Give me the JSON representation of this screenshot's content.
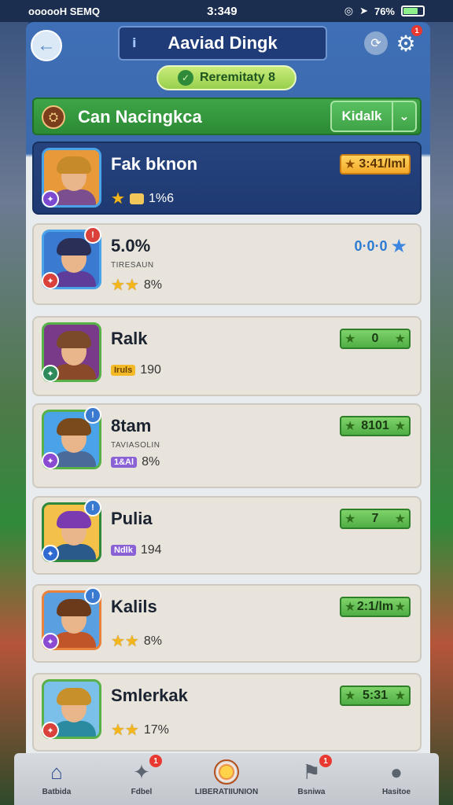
{
  "status_bar": {
    "carrier": "oooooH SEMQ",
    "time": "3:349",
    "battery": "76%",
    "battery_level": 0.76
  },
  "header": {
    "title": "Aaviad Dingk",
    "info_icon": "info-icon",
    "back_icon": "arrow-left-icon",
    "refresh_icon": "refresh-icon",
    "settings_icon": "gear-icon",
    "settings_badge": "1",
    "reward_label": "Reremitaty 8"
  },
  "group": {
    "title": "Can Nacingkca",
    "select_label": "Kidalk"
  },
  "players": [
    {
      "name": "Fak bknon",
      "selected": true,
      "sub": "",
      "stats": "1%6",
      "stars": "★",
      "score": "3:41/lml",
      "score_style": "gold",
      "avatar_colors": {
        "hair": "#c78a2a",
        "body": "#7a4e8f",
        "border": "#4aa2e8",
        "bg": "#e89a3a"
      },
      "badge_color": "#7b4ad1"
    },
    {
      "name": "5.0%",
      "selected": false,
      "sub": "TIRESAUN",
      "stats": "8%",
      "stars": "★★",
      "score": "0·0·0",
      "score_style": "blue",
      "avatar_colors": {
        "hair": "#2a2f58",
        "body": "#5e3d9a",
        "border": "#4aa2e8",
        "bg": "#3a7ad0"
      },
      "badge_color": "#d9413a"
    },
    {
      "name": "Ralk",
      "selected": false,
      "sub": "",
      "stats": "190",
      "tag": "Iruls",
      "score": "0",
      "score_style": "green",
      "avatar_colors": {
        "hair": "#7a4a2a",
        "body": "#8a4a2a",
        "border": "#58b048",
        "bg": "#7a3a8a"
      },
      "badge_color": "#2e8a5a"
    },
    {
      "name": "8tam",
      "selected": false,
      "sub": "TAVIASOLIN",
      "stats": "8%",
      "tag": "1&Al",
      "score": "8101",
      "score_style": "green",
      "avatar_colors": {
        "hair": "#7a4a1a",
        "body": "#4a6a9a",
        "border": "#58b048",
        "bg": "#4aa2e8"
      },
      "badge_color": "#8a4ad1"
    },
    {
      "name": "Pulia",
      "selected": false,
      "sub": "",
      "stats": "194",
      "tag": "Ndlk",
      "score": "7",
      "score_style": "green",
      "avatar_colors": {
        "hair": "#7a3ab0",
        "body": "#2a5a8a",
        "border": "#2e8a3a",
        "bg": "#f3c14a"
      },
      "badge_color": "#2e6ad0"
    },
    {
      "name": "Kalils",
      "selected": false,
      "sub": "",
      "stats": "8%",
      "stars": "★★",
      "score": "2:1/lm",
      "score_style": "green",
      "avatar_colors": {
        "hair": "#6a3a1a",
        "body": "#c0552a",
        "border": "#e8823a",
        "bg": "#5aa0e0"
      },
      "badge_color": "#8a4ad1"
    },
    {
      "name": "Smlerkak",
      "selected": false,
      "sub": "",
      "stats": "17%",
      "stars": "★★",
      "score": "5:31",
      "score_style": "green",
      "avatar_colors": {
        "hair": "#c8902a",
        "body": "#2a8aa0",
        "border": "#58b048",
        "bg": "#7ac0e8"
      },
      "badge_color": "#d9413a"
    }
  ],
  "nav": [
    {
      "label": "Batbida",
      "icon": "home-icon",
      "glyph": "⌂",
      "badge": ""
    },
    {
      "label": "Fdbel",
      "icon": "puzzle-icon",
      "glyph": "✦",
      "badge": "1"
    },
    {
      "label": "LIBERATIIUNION",
      "icon": "coin-icon",
      "glyph": "",
      "badge": ""
    },
    {
      "label": "Bsniwa",
      "icon": "trophy-icon",
      "glyph": "⚑",
      "badge": "1"
    },
    {
      "label": "Hasitoe",
      "icon": "profile-icon",
      "glyph": "●",
      "badge": ""
    }
  ],
  "colors": {
    "accent_blue": "#1f3b78",
    "accent_green": "#3ea547",
    "gold": "#f4b61b",
    "badge_red": "#e8382f"
  }
}
